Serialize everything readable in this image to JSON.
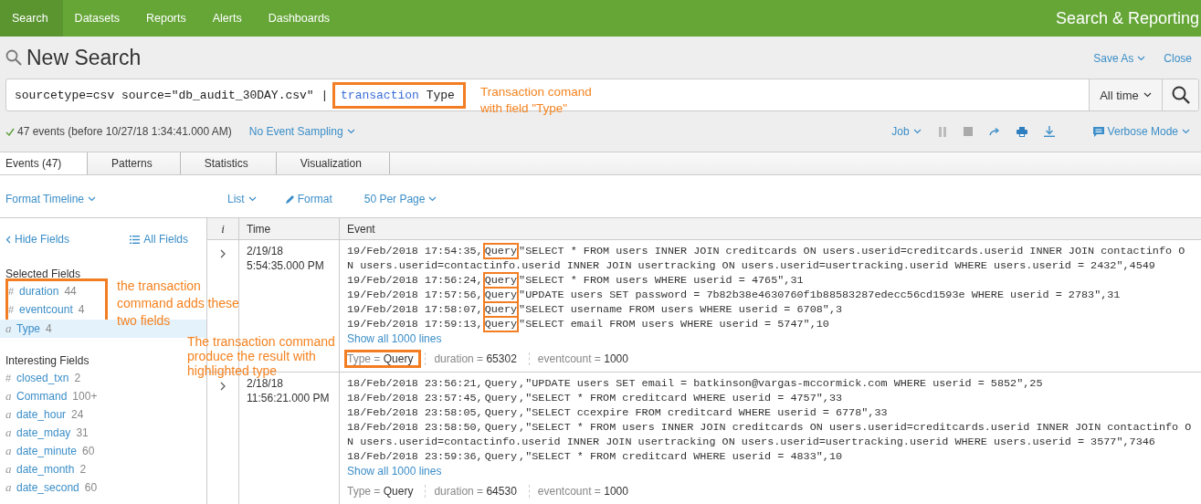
{
  "nav": {
    "tabs": [
      {
        "label": "Search",
        "selected": true
      },
      {
        "label": "Datasets",
        "selected": false
      },
      {
        "label": "Reports",
        "selected": false
      },
      {
        "label": "Alerts",
        "selected": false
      },
      {
        "label": "Dashboards",
        "selected": false
      }
    ],
    "app_title": "Search & Reporting"
  },
  "page_title": "New Search",
  "header_links": [
    "Save As",
    "Close"
  ],
  "search": {
    "before": "sourcetype=csv source=\"db_audit_30DAY.csv\" |",
    "command": "transaction",
    "argument": "Type",
    "boxed": true,
    "time_range": "All time"
  },
  "status": {
    "summary": "47 events (before 10/27/18 1:34:41.000 AM)",
    "sampling": "No Event Sampling",
    "job": "Job",
    "mode": "Verbose Mode"
  },
  "tabs": [
    {
      "label": "Events (47)",
      "selected": true
    },
    {
      "label": "Patterns",
      "selected": false
    },
    {
      "label": "Statistics",
      "selected": false
    },
    {
      "label": "Visualization",
      "selected": false
    }
  ],
  "toolbar": {
    "timeline": "Format Timeline",
    "view": "List",
    "format": "Format",
    "per_page": "50 Per Page"
  },
  "sidebar": {
    "hide": "Hide Fields",
    "all": "All Fields",
    "selected_title": "Selected Fields",
    "selected_fields": [
      {
        "glyph": "#",
        "name": "duration",
        "count": "44",
        "boxed": true,
        "selected": false
      },
      {
        "glyph": "#",
        "name": "eventcount",
        "count": "4",
        "boxed": true,
        "selected": false
      },
      {
        "glyph": "a",
        "name": "Type",
        "count": "4",
        "boxed": false,
        "selected": true
      }
    ],
    "interesting_title": "Interesting Fields",
    "interesting_fields": [
      {
        "glyph": "#",
        "name": "closed_txn",
        "count": "2"
      },
      {
        "glyph": "a",
        "name": "Command",
        "count": "100+"
      },
      {
        "glyph": "a",
        "name": "date_hour",
        "count": "24"
      },
      {
        "glyph": "a",
        "name": "date_mday",
        "count": "31"
      },
      {
        "glyph": "a",
        "name": "date_minute",
        "count": "60"
      },
      {
        "glyph": "a",
        "name": "date_month",
        "count": "2"
      },
      {
        "glyph": "a",
        "name": "date_second",
        "count": "60"
      }
    ]
  },
  "table": {
    "columns": [
      "i",
      "Time",
      "Event"
    ],
    "rows": [
      {
        "date": "2/19/18",
        "time": "5:54:35.000 PM",
        "lines": [
          {
            "kind": "entry",
            "head": "19/Feb/2018 17:54:35,",
            "field": "Query",
            "tail": "\"SELECT * FROM users INNER JOIN creditcards ON users.userid=creditcards.userid INNER JOIN contactinfo O",
            "boxed": true
          },
          {
            "kind": "wrap",
            "text": "N users.userid=contactinfo.userid INNER JOIN usertracking ON users.userid=usertracking.userid WHERE users.userid = 2432\",4549"
          },
          {
            "kind": "entry",
            "head": "19/Feb/2018 17:56:24,",
            "field": "Query",
            "tail": "\"SELECT * FROM users WHERE userid = 4765\",31",
            "boxed": true
          },
          {
            "kind": "entry",
            "head": "19/Feb/2018 17:57:56,",
            "field": "Query",
            "tail": "\"UPDATE users SET password = 7b82b38e4630760f1b88583287edecc56cd1593e WHERE userid = 2783\",31",
            "boxed": true
          },
          {
            "kind": "entry",
            "head": "19/Feb/2018 17:58:07,",
            "field": "Query",
            "tail": "\"SELECT username FROM users WHERE userid = 6708\",3",
            "boxed": true
          },
          {
            "kind": "entry",
            "head": "19/Feb/2018 17:59:13,",
            "field": "Query",
            "tail": "\"SELECT email FROM users WHERE userid = 5747\",10",
            "boxed": true
          }
        ],
        "show_all": "Show all 1000 lines",
        "fields": [
          {
            "label": "Type =",
            "value": "Query",
            "boxed": true
          },
          {
            "label": "duration =",
            "value": "65302",
            "boxed": false
          },
          {
            "label": "eventcount =",
            "value": "1000",
            "boxed": false
          }
        ]
      },
      {
        "date": "2/18/18",
        "time": "11:56:21.000 PM",
        "lines": [
          {
            "kind": "entry",
            "head": "18/Feb/2018 23:56:21,",
            "field": "Query",
            "tail": ",\"UPDATE users SET email = batkinson@vargas-mccormick.com WHERE userid = 5852\",25",
            "boxed": false
          },
          {
            "kind": "entry",
            "head": "18/Feb/2018 23:57:45,",
            "field": "Query",
            "tail": ",\"SELECT * FROM creditcard WHERE userid = 4757\",33",
            "boxed": false
          },
          {
            "kind": "entry",
            "head": "18/Feb/2018 23:58:05,",
            "field": "Query",
            "tail": ",\"SELECT ccexpire FROM creditcard WHERE userid = 6778\",33",
            "boxed": false
          },
          {
            "kind": "entry",
            "head": "18/Feb/2018 23:58:50,",
            "field": "Query",
            "tail": ",\"SELECT * FROM users INNER JOIN creditcards ON users.userid=creditcards.userid INNER JOIN contactinfo O",
            "boxed": false
          },
          {
            "kind": "wrap",
            "text": "N users.userid=contactinfo.userid INNER JOIN usertracking ON users.userid=usertracking.userid WHERE users.userid = 3577\",7346"
          },
          {
            "kind": "entry",
            "head": "18/Feb/2018 23:59:36,",
            "field": "Query",
            "tail": ",\"SELECT * FROM creditcard WHERE userid = 4833\",10",
            "boxed": false
          }
        ],
        "show_all": "Show all 1000 lines",
        "fields": [
          {
            "label": "Type =",
            "value": "Query",
            "boxed": false
          },
          {
            "label": "duration =",
            "value": "64530",
            "boxed": false
          },
          {
            "label": "eventcount =",
            "value": "1000",
            "boxed": false
          }
        ]
      }
    ]
  },
  "annotations": [
    {
      "text": "Transaction comand with field \"Type\""
    },
    {
      "text": "the transaction command adds these two fields"
    },
    {
      "text": "The transaction command produce the result with highlighted type"
    }
  ]
}
